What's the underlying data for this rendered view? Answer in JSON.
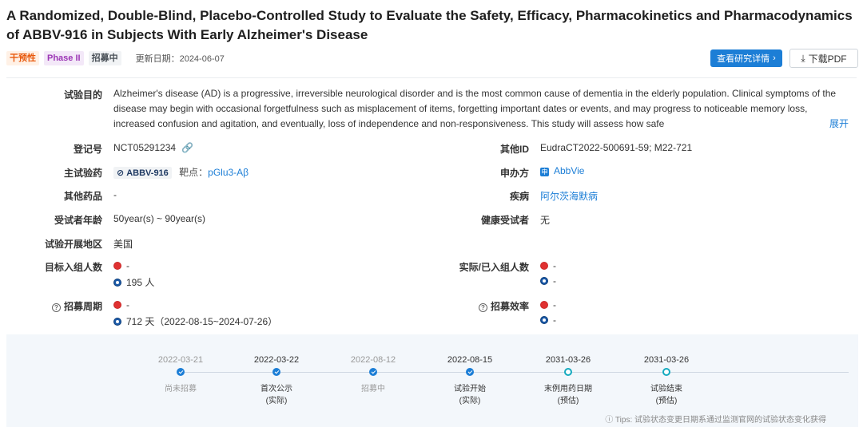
{
  "header": {
    "title": "A Randomized, Double-Blind, Placebo-Controlled Study to Evaluate the Safety, Efficacy, Pharmacokinetics and Pharmacodynamics of ABBV-916 in Subjects With Early Alzheimer's Disease",
    "tags": [
      "干预性",
      "Phase II",
      "招募中"
    ],
    "update_label": "更新日期：",
    "update_date": "2024-06-07",
    "detail_button": "查看研究详情",
    "pdf_button": "下载PDF"
  },
  "fields": {
    "purpose_label": "试验目的",
    "purpose_text": "Alzheimer's disease (AD) is a progressive, irreversible neurological disorder and is the most common cause of dementia in the elderly population. Clinical symptoms of the disease may begin with occasional forgetfulness such as misplacement of items, forgetting important dates or events, and may progress to noticeable memory loss, increased confusion and agitation, and eventually, loss of independence and non-responsiveness. This study will assess how safe",
    "expand_label": "展开",
    "reg_label": "登记号",
    "reg_value": "NCT05291234",
    "other_id_label": "其他ID",
    "other_id_value": "EudraCT2022-500691-59; M22-721",
    "drug_label": "主试验药",
    "drug_value": "ABBV-916",
    "target_label": "靶点：",
    "target_value": "pGlu3-Aβ",
    "sponsor_label": "申办方",
    "sponsor_value": "AbbVie",
    "other_drug_label": "其他药品",
    "other_drug_value": "-",
    "disease_label": "疾病",
    "disease_value": "阿尔茨海默病",
    "age_label": "受试者年龄",
    "age_value": "50year(s) ~ 90year(s)",
    "healthy_label": "健康受试者",
    "healthy_value": "无",
    "region_label": "试验开展地区",
    "region_value": "美国",
    "target_enroll_label": "目标入组人数",
    "target_enroll_cn": "-",
    "target_enroll_global": "195 人",
    "actual_enroll_label": "实际/已入组人数",
    "actual_enroll_cn": "-",
    "actual_enroll_global": "-",
    "period_label": "招募周期",
    "period_cn": "-",
    "period_global": "712 天（2022-08-15~2024-07-26）",
    "efficiency_label": "招募效率",
    "efficiency_cn": "-",
    "efficiency_global": "-"
  },
  "timeline": {
    "items": [
      {
        "date": "2022-03-21",
        "label1": "尚未招募",
        "label2": "",
        "state": "done",
        "highlight": false
      },
      {
        "date": "2022-03-22",
        "label1": "首次公示",
        "label2": "(实际)",
        "state": "done",
        "highlight": true
      },
      {
        "date": "2022-08-12",
        "label1": "招募中",
        "label2": "",
        "state": "done",
        "highlight": false
      },
      {
        "date": "2022-08-15",
        "label1": "试验开始",
        "label2": "(实际)",
        "state": "done",
        "highlight": true
      },
      {
        "date": "2031-03-26",
        "label1": "末例用药日期",
        "label2": "(预估)",
        "state": "future",
        "highlight": true
      },
      {
        "date": "2031-03-26",
        "label1": "试验结束",
        "label2": "(预估)",
        "state": "future",
        "highlight": true
      }
    ],
    "tips": "Tips: 试验状态变更日期系通过监测官网的试验状态变化获得"
  },
  "colors": {
    "primary": "#1c7ed6",
    "future_node": "#15aabf",
    "red_flag": "#e03131"
  }
}
